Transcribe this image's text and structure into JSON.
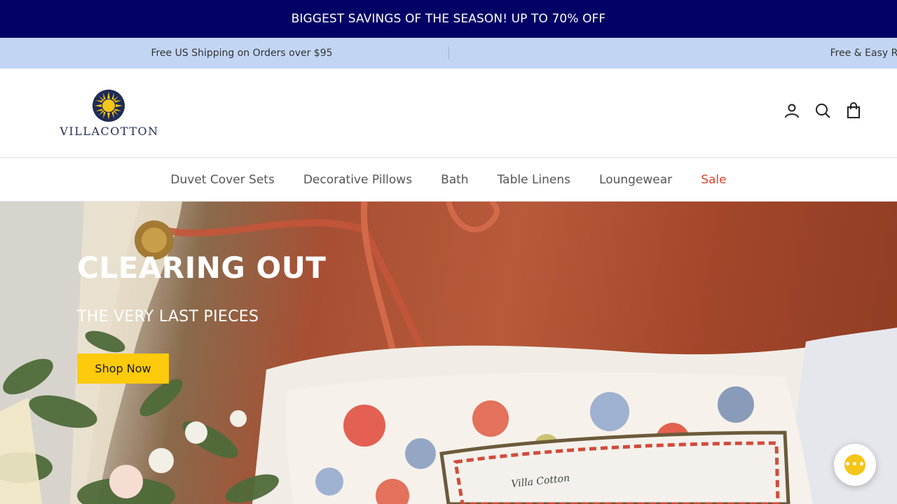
{
  "promo": {
    "text": "BIGGEST SAVINGS OF THE SEASON! UP TO 70% OFF",
    "bg": "#030066"
  },
  "info_bar": {
    "left": "Free US Shipping on Orders over $95",
    "right": "Free & Easy Returns",
    "bg": "#c2d6f4"
  },
  "header": {
    "logo_text": "VILLACOTTON",
    "icons": {
      "account": "account-icon",
      "search": "search-icon",
      "cart": "cart-icon"
    }
  },
  "nav": {
    "items": [
      {
        "label": "Duvet Cover Sets"
      },
      {
        "label": "Decorative Pillows"
      },
      {
        "label": "Bath"
      },
      {
        "label": "Table Linens"
      },
      {
        "label": "Loungewear"
      },
      {
        "label": "Sale"
      }
    ],
    "sale_color": "#e0452e"
  },
  "hero": {
    "title": "CLEARING OUT",
    "subtitle": "THE VERY LAST PIECES",
    "cta": "Shop Now",
    "cta_color": "#fdca0c",
    "pillow_text": "Villa Cotton"
  },
  "chat": {
    "icon": "chat-icon",
    "glyph": "•••"
  }
}
